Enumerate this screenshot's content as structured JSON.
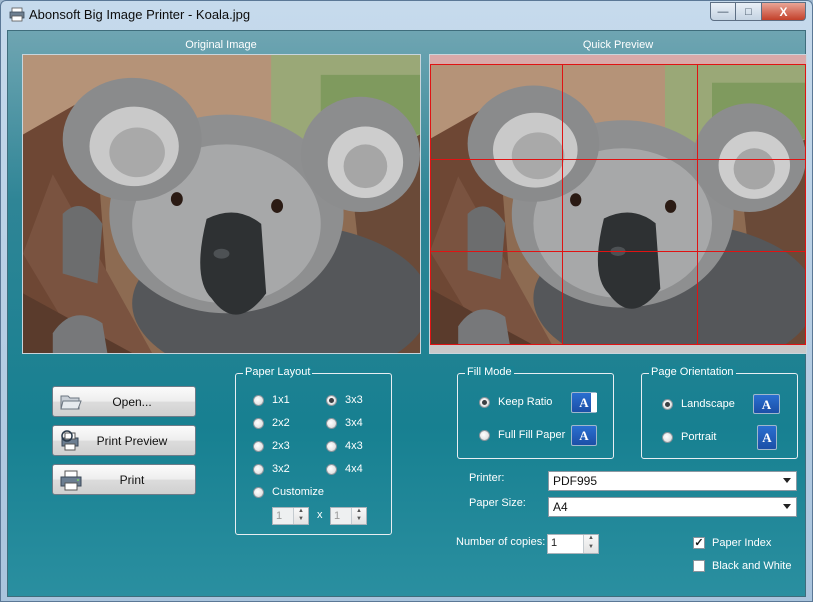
{
  "window": {
    "title": "Abonsoft Big Image Printer - Koala.jpg",
    "controls": {
      "minimize": "—",
      "maximize": "□",
      "close": "X"
    }
  },
  "panels": {
    "original_label": "Original Image",
    "preview_label": "Quick Preview"
  },
  "buttons": {
    "open": "Open...",
    "print_preview": "Print Preview",
    "print": "Print"
  },
  "paper_layout": {
    "title": "Paper Layout",
    "options": [
      "1x1",
      "2x2",
      "2x3",
      "3x2",
      "3x3",
      "3x4",
      "4x3",
      "4x4"
    ],
    "selected": "3x3",
    "customize_label": "Customize",
    "custom_cols": "1",
    "custom_rows": "1",
    "times": "x"
  },
  "fill_mode": {
    "title": "Fill Mode",
    "keep_ratio": "Keep Ratio",
    "full_fill_paper": "Full Fill Paper",
    "selected": "Keep Ratio"
  },
  "page_orientation": {
    "title": "Page Orientation",
    "landscape": "Landscape",
    "portrait": "Portrait",
    "selected": "Landscape"
  },
  "printer": {
    "label": "Printer:",
    "value": "PDF995"
  },
  "paper_size": {
    "label": "Paper Size:",
    "value": "A4"
  },
  "copies": {
    "label": "Number of copies:",
    "value": "1"
  },
  "options": {
    "paper_index": {
      "label": "Paper Index",
      "checked": true
    },
    "black_and_white": {
      "label": "Black and White",
      "checked": false
    }
  },
  "preview_grid": {
    "columns": 3,
    "rows": 3
  },
  "icons": {
    "app": "printer-app-icon",
    "open": "folder-open-icon",
    "print_preview": "print-preview-icon",
    "print": "printer-icon",
    "keep_ratio": "keep-ratio-icon",
    "full_fill": "full-fill-icon",
    "landscape": "landscape-icon",
    "portrait": "portrait-icon",
    "mode_glyph": "A"
  },
  "colors": {
    "accent": "#198394",
    "grid_line": "#e01313"
  }
}
